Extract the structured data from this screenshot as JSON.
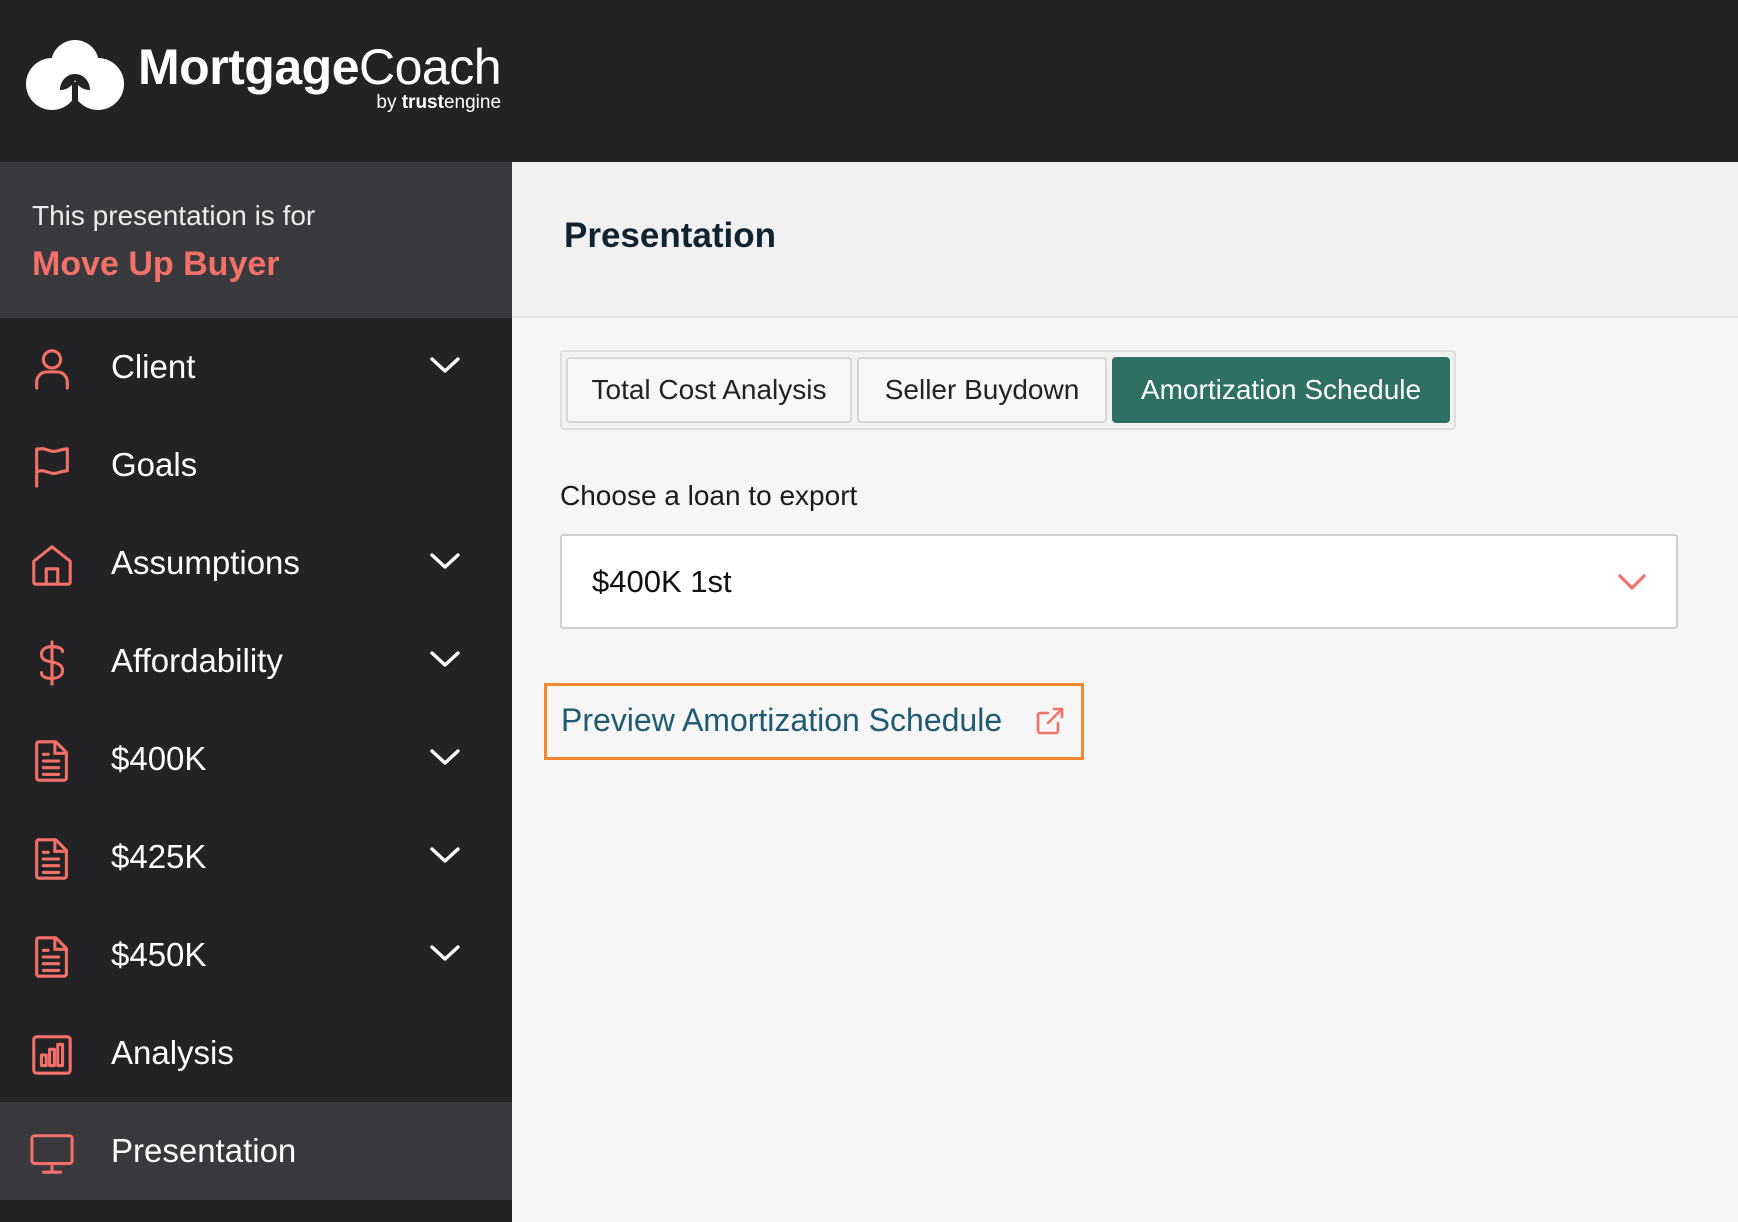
{
  "brand": {
    "name_bold": "Mortgage",
    "name_light": "Coach",
    "by": "by ",
    "by_bold": "trust",
    "by_light": "engine"
  },
  "sidebar": {
    "for_text": "This presentation is for",
    "client_name": "Move Up Buyer",
    "items": [
      {
        "label": "Client",
        "icon": "person-icon",
        "expandable": true
      },
      {
        "label": "Goals",
        "icon": "flag-icon",
        "expandable": false
      },
      {
        "label": "Assumptions",
        "icon": "home-icon",
        "expandable": true
      },
      {
        "label": "Affordability",
        "icon": "dollar-icon",
        "expandable": true
      },
      {
        "label": "$400K",
        "icon": "document-icon",
        "expandable": true
      },
      {
        "label": "$425K",
        "icon": "document-icon",
        "expandable": true
      },
      {
        "label": "$450K",
        "icon": "document-icon",
        "expandable": true
      },
      {
        "label": "Analysis",
        "icon": "chart-icon",
        "expandable": false
      },
      {
        "label": "Presentation",
        "icon": "monitor-icon",
        "expandable": false,
        "active": true
      }
    ]
  },
  "main": {
    "title": "Presentation",
    "tabs": [
      {
        "label": "Total Cost Analysis",
        "active": false
      },
      {
        "label": "Seller Buydown",
        "active": false
      },
      {
        "label": "Amortization Schedule",
        "active": true
      }
    ],
    "loan_label": "Choose a loan to export",
    "loan_selected": "$400K 1st",
    "preview_link": "Preview Amortization Schedule"
  },
  "colors": {
    "accent": "#f37169",
    "active_tab": "#2e7061",
    "link": "#1f5a70",
    "highlight": "#f3872e",
    "dark": "#232325"
  }
}
